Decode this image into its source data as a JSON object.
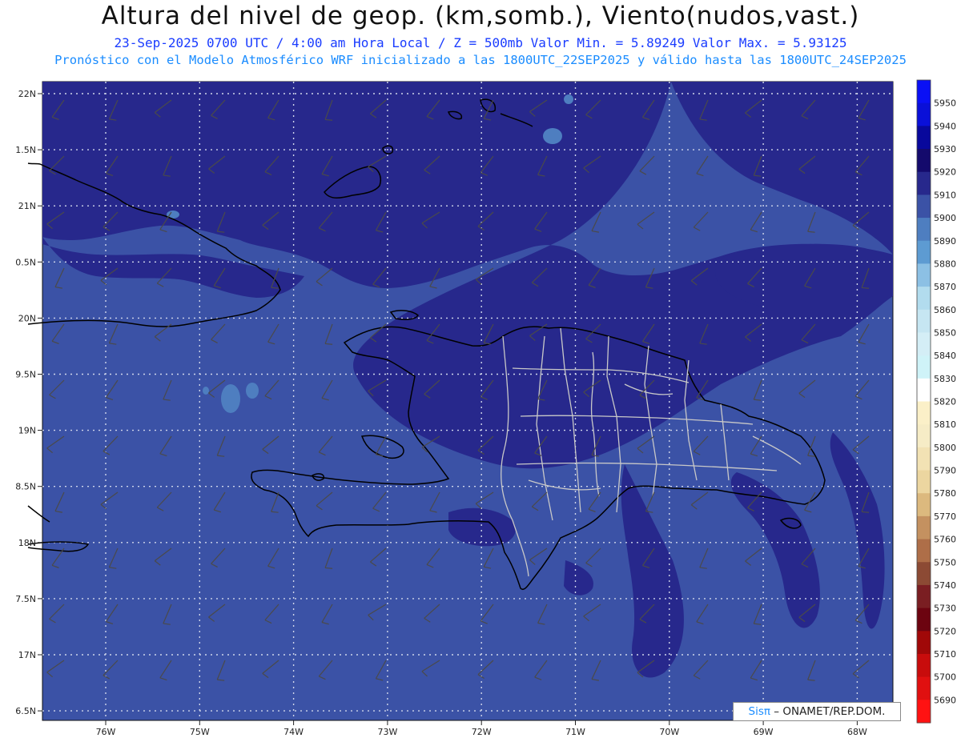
{
  "header": {
    "title": "Altura del nivel de geop. (km,somb.), Viento(nudos,vast.)",
    "subtitle_line1": "23-Sep-2025  0700 UTC / 4:00 am Hora Local / Z = 500mb     Valor Min. = 5.89249  Valor Max. = 5.93125",
    "subtitle_line2": "Pronóstico con el Modelo Atmosférico WRF inicializado a las 1800UTC_22SEP2025 y válido hasta las  1800UTC_24SEP2025"
  },
  "axes": {
    "lat_labels": [
      "22N",
      "1.5N",
      "21N",
      "0.5N",
      "20N",
      "9.5N",
      "19N",
      "8.5N",
      "18N",
      "7.5N",
      "17N",
      "6.5N"
    ],
    "lon_labels": [
      "76W",
      "75W",
      "74W",
      "73W",
      "72W",
      "71W",
      "70W",
      "69W",
      "68W"
    ]
  },
  "colorbar": {
    "levels": [
      {
        "label": "5950",
        "color": "#0a10f5"
      },
      {
        "label": "5940",
        "color": "#0a10d8"
      },
      {
        "label": "5930",
        "color": "#08089c"
      },
      {
        "label": "5920",
        "color": "#140a6c"
      },
      {
        "label": "5910",
        "color": "#27288c"
      },
      {
        "label": "5900",
        "color": "#3b52a6"
      },
      {
        "label": "5890",
        "color": "#4e7ec0"
      },
      {
        "label": "5880",
        "color": "#5d9bd2"
      },
      {
        "label": "5870",
        "color": "#8cc0e4"
      },
      {
        "label": "5860",
        "color": "#b2dcee"
      },
      {
        "label": "5850",
        "color": "#c6e6f2"
      },
      {
        "label": "5840",
        "color": "#d4eef6"
      },
      {
        "label": "5830",
        "color": "#cff3f8"
      },
      {
        "label": "5820",
        "color": "#ffffff"
      },
      {
        "label": "5810",
        "color": "#fbf0c8"
      },
      {
        "label": "5800",
        "color": "#f6ecc6"
      },
      {
        "label": "5790",
        "color": "#f2e2b4"
      },
      {
        "label": "5780",
        "color": "#ecd6a0"
      },
      {
        "label": "5770",
        "color": "#dcb97e"
      },
      {
        "label": "5760",
        "color": "#c49160"
      },
      {
        "label": "5750",
        "color": "#ae6e48"
      },
      {
        "label": "5740",
        "color": "#8c4a34"
      },
      {
        "label": "5730",
        "color": "#7a1e22"
      },
      {
        "label": "5720",
        "color": "#6c0410"
      },
      {
        "label": "5710",
        "color": "#a00808"
      },
      {
        "label": "5700",
        "color": "#c80c0c"
      },
      {
        "label": "5690",
        "color": "#e01010"
      },
      {
        "label": "",
        "color": "#ff1212"
      }
    ]
  },
  "credit": {
    "brand": "Sisπ",
    "text": "– ONAMET/REP.DOM."
  },
  "colors": {
    "field_base": "#3b52a6",
    "field_high": "#27288c",
    "field_low": "#4e7ec0",
    "coast": "#000000",
    "provinces": "#c8c8c8",
    "grid": "#d0d6ea"
  }
}
